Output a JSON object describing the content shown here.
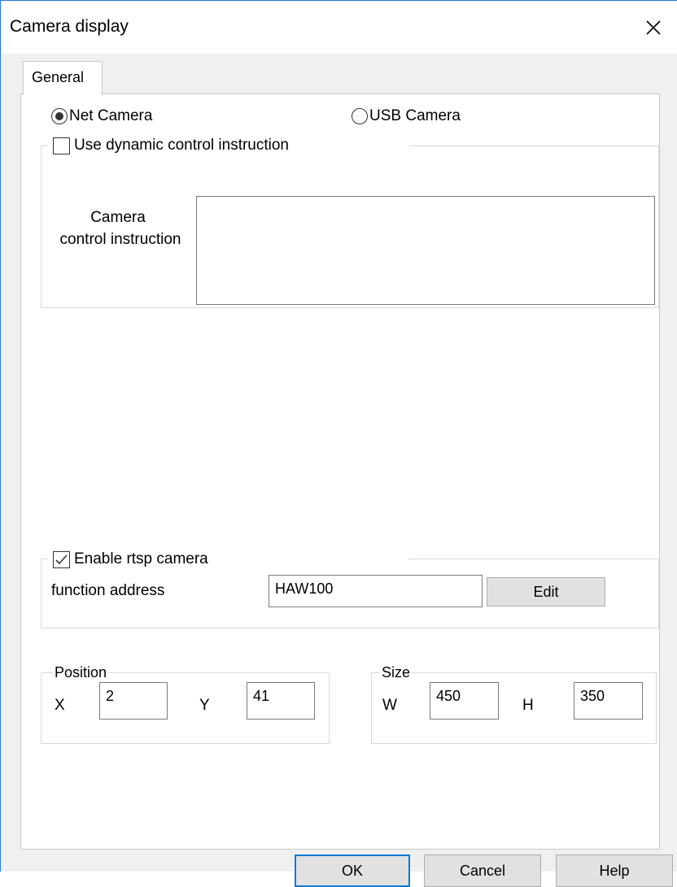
{
  "window": {
    "title": "Camera display"
  },
  "tabs": [
    {
      "label": "General"
    }
  ],
  "camera_type": {
    "options": [
      {
        "label": "Net Camera",
        "selected": true
      },
      {
        "label": "USB Camera",
        "selected": false
      }
    ]
  },
  "dynamic_control": {
    "checkbox_label": "Use dynamic control instruction",
    "checked": false,
    "instruction_label_line1": "Camera",
    "instruction_label_line2": "control instruction",
    "instruction_value": ""
  },
  "rtsp": {
    "checkbox_label": "Enable rtsp camera",
    "checked": true,
    "function_address_label": "function address",
    "function_address_value": "HAW100",
    "edit_button": "Edit"
  },
  "position": {
    "label": "Position",
    "x_label": "X",
    "x_value": "2",
    "y_label": "Y",
    "y_value": "41"
  },
  "size": {
    "label": "Size",
    "w_label": "W",
    "w_value": "450",
    "h_label": "H",
    "h_value": "350"
  },
  "buttons": {
    "ok": "OK",
    "cancel": "Cancel",
    "help": "Help"
  },
  "icons": {
    "close": "close-icon",
    "check": "checkmark-icon"
  },
  "colors": {
    "window_border": "#2b79d6",
    "default_button_border": "#0078d7",
    "dialog_bg": "#f0f0f0",
    "button_bg": "#e1e1e1"
  }
}
